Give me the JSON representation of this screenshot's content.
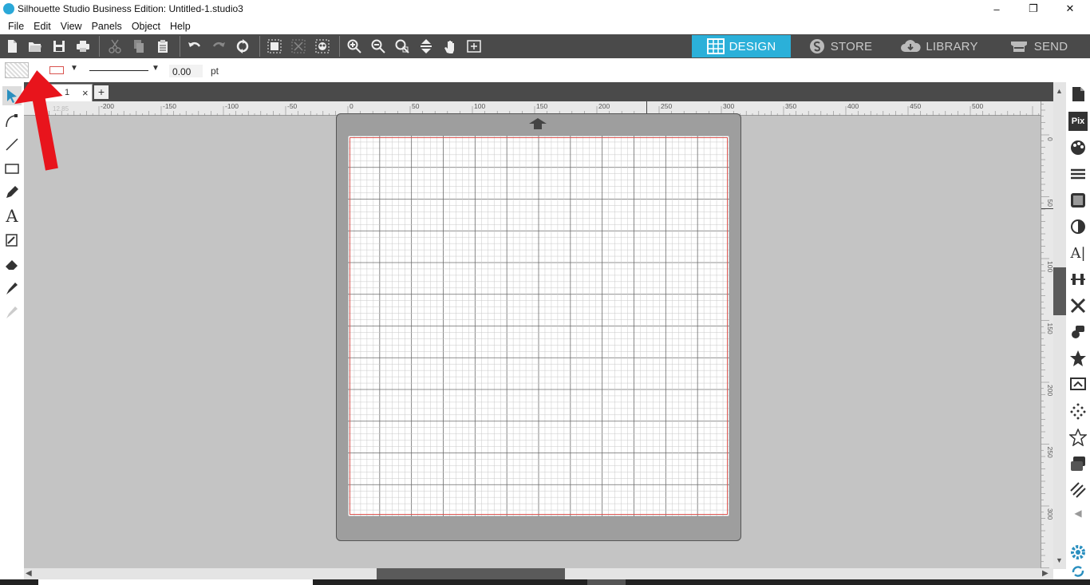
{
  "window": {
    "title": "Silhouette Studio Business Edition: Untitled-1.studio3",
    "controls": {
      "minimize": "–",
      "maximize": "❐",
      "close": "✕"
    }
  },
  "menu": [
    "File",
    "Edit",
    "View",
    "Panels",
    "Object",
    "Help"
  ],
  "toolbar": {
    "tool_icons": [
      "new-document-icon",
      "open-folder-icon",
      "save-icon",
      "print-icon",
      "cut-icon",
      "copy-icon",
      "paste-icon",
      "undo-icon",
      "redo-icon",
      "redraw-icon",
      "group-icon",
      "ungroup-icon",
      "compound-path-icon",
      "zoom-in-icon",
      "zoom-out-icon",
      "zoom-selection-icon",
      "fit-to-page-icon",
      "pan-hand-icon",
      "add-page-icon"
    ]
  },
  "mode_tabs": [
    {
      "label": "DESIGN",
      "icon": "grid-icon",
      "active": true
    },
    {
      "label": "STORE",
      "icon": "silhouette-s-icon",
      "active": false
    },
    {
      "label": "LIBRARY",
      "icon": "cloud-download-icon",
      "active": false
    },
    {
      "label": "SEND",
      "icon": "cutter-icon",
      "active": false
    }
  ],
  "properties": {
    "line_weight_value": "0.00",
    "line_weight_unit": "pt"
  },
  "document_tab": {
    "label": "1",
    "close": "×",
    "add": "+"
  },
  "rulers": {
    "top_ticks": [
      "-200",
      "-150",
      "-100",
      "-50",
      "0",
      "50",
      "100",
      "150",
      "200",
      "250",
      "300",
      "350",
      "400",
      "450",
      "500"
    ],
    "left_ticks": [
      "0",
      "50",
      "100",
      "150",
      "200",
      "250",
      "300"
    ],
    "faint_label": "12.85"
  },
  "colors": {
    "accent": "#2bb0d9",
    "toolbar": "#4a4a4a",
    "canvas": "#c4c4c4",
    "mat": "#9e9e9e",
    "cut_border": "#d9534f",
    "annotation_arrow": "#e8141c"
  },
  "annotation": {
    "type": "red-arrow",
    "points_to": "open-folder-icon"
  },
  "left_tools": [
    "select-arrow-icon",
    "point-edit-icon",
    "line-tool-icon",
    "rectangle-tool-icon",
    "pencil-tool-icon",
    "text-tool-icon",
    "sketch-tool-icon",
    "eraser-tool-icon",
    "knife-tool-icon",
    "eyedropper-icon"
  ],
  "right_panels": [
    "page-setup-icon",
    "pixscan-icon",
    "fill-color-icon",
    "line-style-icon",
    "fill-pattern-icon",
    "contrast-icon",
    "text-style-icon",
    "align-icon",
    "transform-icon",
    "replicate-icon",
    "library-star-icon",
    "trace-icon",
    "dots-icon",
    "star-outline-icon",
    "layers-icon",
    "hatch-icon",
    "collapse-arrow-icon",
    "settings-gear-icon",
    "refresh-icon"
  ],
  "pixscan_label": "Pix",
  "text_style_label": "A|"
}
